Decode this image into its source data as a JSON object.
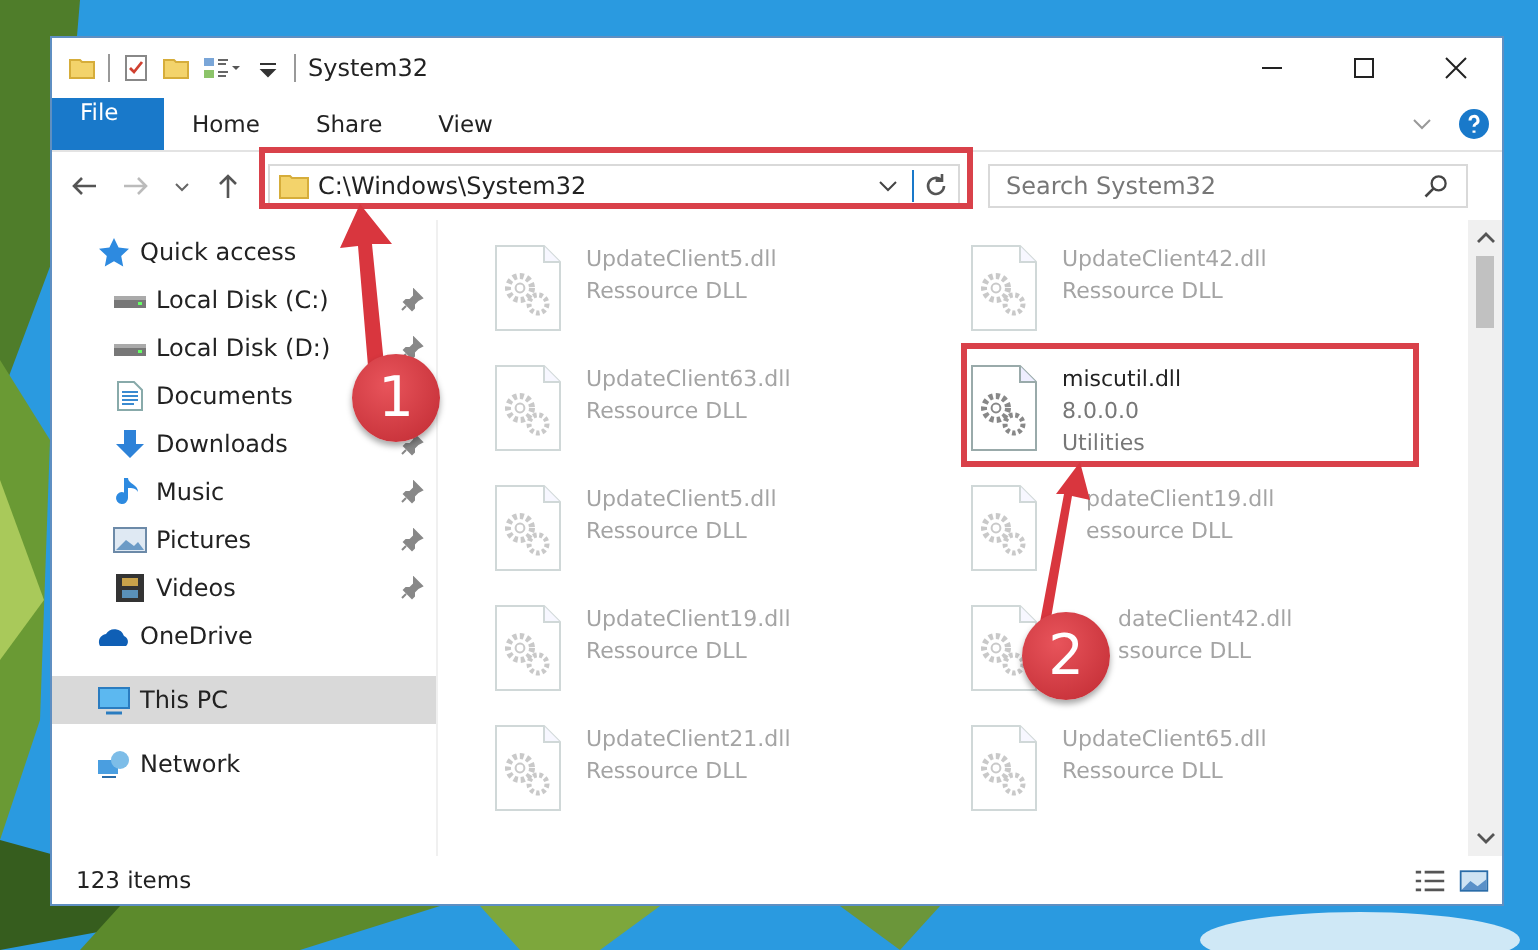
{
  "window": {
    "title": "System32"
  },
  "ribbon_tabs": [
    {
      "label": "File",
      "kind": "file",
      "selected": false
    },
    {
      "label": "Home",
      "kind": "tab",
      "selected": false
    },
    {
      "label": "Share",
      "kind": "tab",
      "selected": false
    },
    {
      "label": "View",
      "kind": "tab",
      "selected": false
    }
  ],
  "address_bar": {
    "path": "C:\\Windows\\System32"
  },
  "search": {
    "placeholder": "Search System32"
  },
  "navigation": [
    {
      "label": "Quick access",
      "kind": "star",
      "selected": false,
      "children": [
        {
          "label": "Local Disk (C:)",
          "kind": "drive",
          "pinned": true,
          "selected": false
        },
        {
          "label": "Local Disk (D:)",
          "kind": "drive",
          "pinned": true,
          "selected": false
        },
        {
          "label": "Documents",
          "kind": "document",
          "pinned": false,
          "selected": false
        },
        {
          "label": "Downloads",
          "kind": "download",
          "pinned": true,
          "selected": false
        },
        {
          "label": "Music",
          "kind": "music",
          "pinned": true,
          "selected": false
        },
        {
          "label": "Pictures",
          "kind": "pictures",
          "pinned": true,
          "selected": false
        },
        {
          "label": "Videos",
          "kind": "videos",
          "pinned": true,
          "selected": false
        }
      ]
    },
    {
      "label": "OneDrive",
      "kind": "cloud",
      "selected": false
    },
    {
      "label": "This PC",
      "kind": "pc",
      "selected": true
    },
    {
      "label": "Network",
      "kind": "network",
      "selected": false
    }
  ],
  "files": [
    {
      "name": "UpdateClient5.dll",
      "details": [
        "Ressource DLL"
      ],
      "blurred": true,
      "kind": "file"
    },
    {
      "name": "UpdateClient42.dll",
      "details": [
        "Ressource DLL"
      ],
      "blurred": true,
      "kind": "file"
    },
    {
      "name": "UpdateClient63.dll",
      "details": [
        "Ressource DLL"
      ],
      "blurred": true,
      "kind": "file"
    },
    {
      "name": "miscutil.dll",
      "details": [
        "8.0.0.0",
        "Utilities"
      ],
      "blurred": false,
      "kind": "file"
    },
    {
      "name": "UpdateClient5.dll",
      "details": [
        "Ressource DLL"
      ],
      "blurred": true,
      "kind": "file"
    },
    {
      "name": "pdateClient19.dll",
      "details": [
        "essource DLL"
      ],
      "blurred": true,
      "kind": "arrow_covered"
    },
    {
      "name": "UpdateClient19.dll",
      "details": [
        "Ressource DLL"
      ],
      "blurred": true,
      "kind": "file"
    },
    {
      "name": "dateClient42.dll",
      "details": [
        "ssource DLL"
      ],
      "blurred": true,
      "kind": "badge_covered"
    },
    {
      "name": "UpdateClient21.dll",
      "details": [
        "Ressource DLL"
      ],
      "blurred": true,
      "kind": "file"
    },
    {
      "name": "UpdateClient65.dll",
      "details": [
        "Ressource DLL"
      ],
      "blurred": true,
      "kind": "file"
    }
  ],
  "status_bar": {
    "item_count": "123 items"
  },
  "callouts": [
    {
      "number": "1"
    },
    {
      "number": "2"
    }
  ]
}
